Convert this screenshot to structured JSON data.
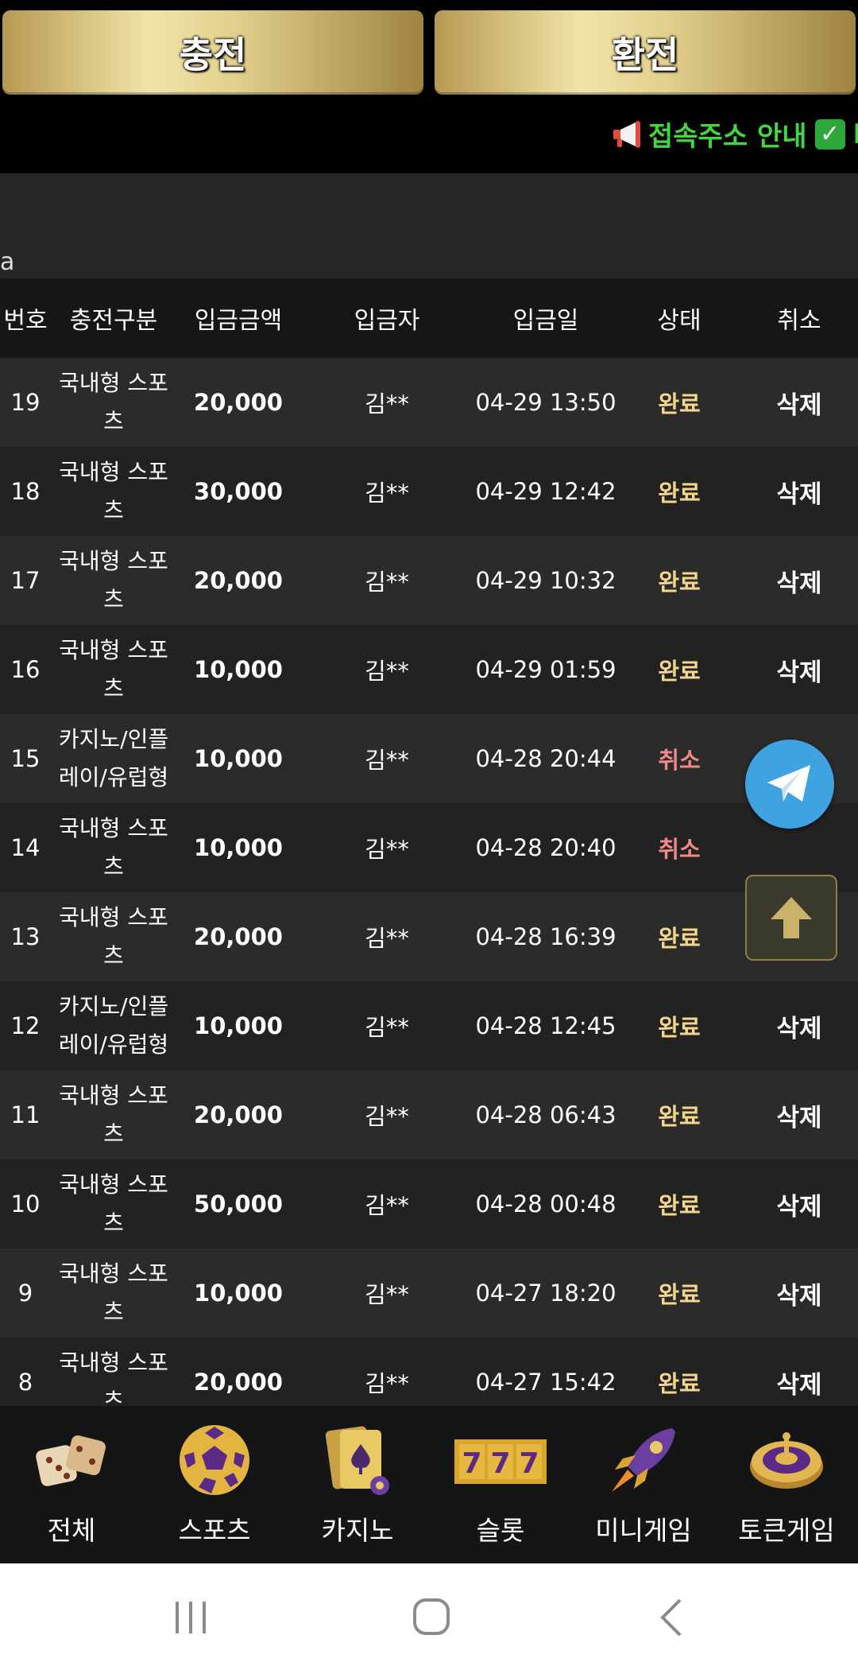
{
  "top_buttons": {
    "deposit": "충전",
    "withdraw": "환전"
  },
  "notice": {
    "text": "접속주소 안내",
    "trailing": "L"
  },
  "section": {
    "label": "a"
  },
  "table": {
    "headers": [
      "번호",
      "충전구분",
      "입금금액",
      "입금자",
      "입금일",
      "상태",
      "취소"
    ],
    "rows": [
      {
        "no": "19",
        "type": "국내형 스포츠",
        "amount": "20,000",
        "depositor": "김**",
        "date": "04-29 13:50",
        "status": "완료",
        "cancel": "삭제"
      },
      {
        "no": "18",
        "type": "국내형 스포츠",
        "amount": "30,000",
        "depositor": "김**",
        "date": "04-29 12:42",
        "status": "완료",
        "cancel": "삭제"
      },
      {
        "no": "17",
        "type": "국내형 스포츠",
        "amount": "20,000",
        "depositor": "김**",
        "date": "04-29 10:32",
        "status": "완료",
        "cancel": "삭제"
      },
      {
        "no": "16",
        "type": "국내형 스포츠",
        "amount": "10,000",
        "depositor": "김**",
        "date": "04-29 01:59",
        "status": "완료",
        "cancel": "삭제"
      },
      {
        "no": "15",
        "type": "카지노/인플레이/유럽형",
        "amount": "10,000",
        "depositor": "김**",
        "date": "04-28 20:44",
        "status": "취소",
        "cancel": ""
      },
      {
        "no": "14",
        "type": "국내형 스포츠",
        "amount": "10,000",
        "depositor": "김**",
        "date": "04-28 20:40",
        "status": "취소",
        "cancel": ""
      },
      {
        "no": "13",
        "type": "국내형 스포츠",
        "amount": "20,000",
        "depositor": "김**",
        "date": "04-28 16:39",
        "status": "완료",
        "cancel": ""
      },
      {
        "no": "12",
        "type": "카지노/인플레이/유럽형",
        "amount": "10,000",
        "depositor": "김**",
        "date": "04-28 12:45",
        "status": "완료",
        "cancel": "삭제"
      },
      {
        "no": "11",
        "type": "국내형 스포츠",
        "amount": "20,000",
        "depositor": "김**",
        "date": "04-28 06:43",
        "status": "완료",
        "cancel": "삭제"
      },
      {
        "no": "10",
        "type": "국내형 스포츠",
        "amount": "50,000",
        "depositor": "김**",
        "date": "04-28 00:48",
        "status": "완료",
        "cancel": "삭제"
      },
      {
        "no": "9",
        "type": "국내형 스포츠",
        "amount": "10,000",
        "depositor": "김**",
        "date": "04-27 18:20",
        "status": "완료",
        "cancel": "삭제"
      },
      {
        "no": "8",
        "type": "국내형 스포츠",
        "amount": "20,000",
        "depositor": "김**",
        "date": "04-27 15:42",
        "status": "완료",
        "cancel": "삭제"
      }
    ]
  },
  "bottom_nav": [
    {
      "label": "전체",
      "icon": "dice-icon"
    },
    {
      "label": "스포츠",
      "icon": "soccer-ball-icon"
    },
    {
      "label": "카지노",
      "icon": "playing-cards-icon"
    },
    {
      "label": "슬롯",
      "icon": "slot-777-icon"
    },
    {
      "label": "미니게임",
      "icon": "rocket-icon"
    },
    {
      "label": "토큰게임",
      "icon": "roulette-icon"
    }
  ],
  "colors": {
    "status_done": "#f5d78a",
    "status_cancel": "#ef8a8a",
    "notice_green": "#43d63e",
    "gold": "#e2cf8e",
    "telegram": "#3ea3e0"
  }
}
